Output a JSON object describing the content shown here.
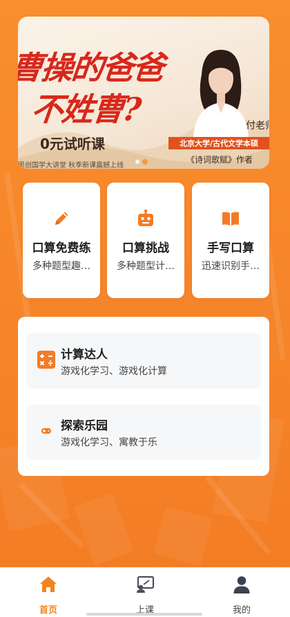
{
  "banner": {
    "headline_line1": "曹操的爸爸",
    "headline_line2": "不姓曹?",
    "free_trial": "0元试听课",
    "tagline": "思创国学大讲堂  秋季新课震撼上线",
    "teacher_name": "付老师",
    "teacher_title": "北京大学/古代文学本硕",
    "teacher_book": "《诗词歌赋》作者",
    "slides_total": 2,
    "slide_active": 2
  },
  "cards": [
    {
      "title": "口算免费练",
      "desc": "多种题型趣…",
      "icon": "pencil-icon"
    },
    {
      "title": "口算挑战",
      "desc": "多种题型计…",
      "icon": "robot-icon"
    },
    {
      "title": "手写口算",
      "desc": "迅速识别手…",
      "icon": "book-icon"
    }
  ],
  "panel": {
    "items": [
      {
        "title": "计算达人",
        "desc": "游戏化学习、游戏化计算",
        "icon": "calculator-icon"
      },
      {
        "title": "探索乐园",
        "desc": "游戏化学习、寓教于乐",
        "icon": "gamepad-icon"
      }
    ]
  },
  "tabbar": {
    "tabs": [
      {
        "label": "首页",
        "icon": "home-icon",
        "active": true
      },
      {
        "label": "上课",
        "icon": "classroom-icon",
        "active": false
      },
      {
        "label": "我的",
        "icon": "profile-icon",
        "active": false
      }
    ]
  },
  "colors": {
    "background": "#f7862a",
    "accent": "#f2841f",
    "banner_red": "#d7281b",
    "badge": "#e0521e"
  }
}
